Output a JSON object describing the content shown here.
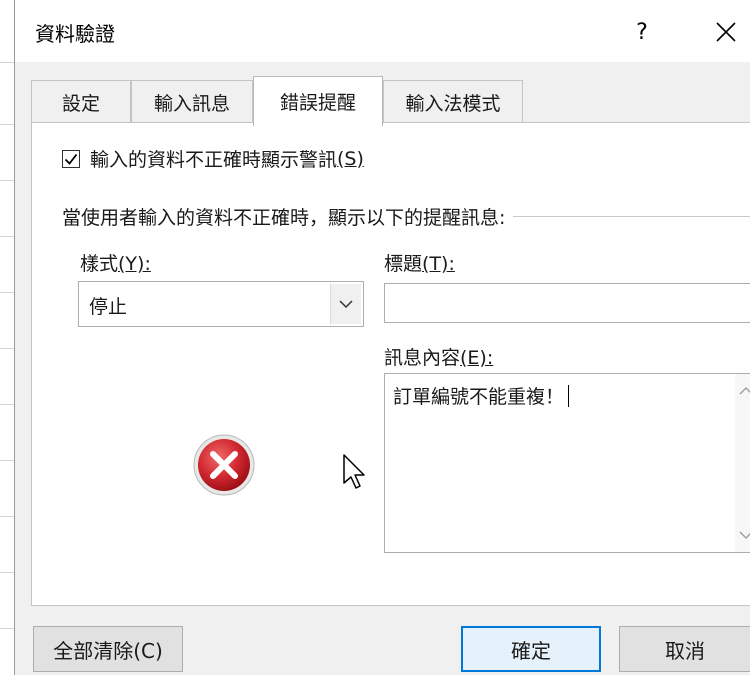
{
  "dialog": {
    "title": "資料驗證",
    "help_label": "?",
    "close_label": "✕"
  },
  "tabs": [
    {
      "label": "設定",
      "active": false
    },
    {
      "label": "輸入訊息",
      "active": false
    },
    {
      "label": "錯誤提醒",
      "active": true
    },
    {
      "label": "輸入法模式",
      "active": false
    }
  ],
  "error_alert": {
    "show_alert_label": "輸入的資料不正確時顯示警訊",
    "show_alert_key": "(S)",
    "show_alert_checked": true,
    "section_label": "當使用者輸入的資料不正確時，顯示以下的提醒訊息:",
    "style_label": "樣式",
    "style_key": "(Y):",
    "style_value": "停止",
    "title_label": "標題",
    "title_key": "(T):",
    "title_value": "",
    "message_label": "訊息內容",
    "message_key": "(E):",
    "message_value": "訂單編號不能重複！",
    "style_icon": "stop-error-icon"
  },
  "buttons": {
    "clear_all": "全部清除(C)",
    "ok": "確定",
    "cancel": "取消"
  },
  "colors": {
    "accent": "#0078d7",
    "error_icon": "#d0282f"
  }
}
